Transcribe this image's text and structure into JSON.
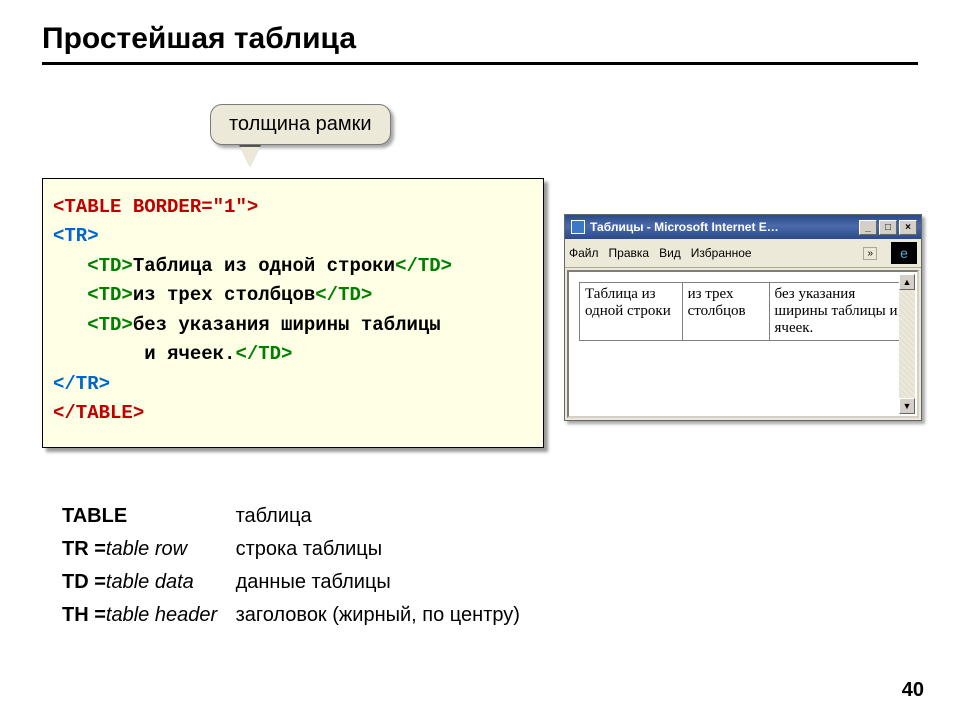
{
  "title": "Простейшая таблица",
  "callout": "толщина рамки",
  "code": {
    "line1_open": "<TABLE",
    "line1_attr": " BORDER=\"1\"",
    "line1_close": ">",
    "line2": "<TR>",
    "line3_open": "<TD>",
    "line3_text": "Таблица из одной строки",
    "line3_close": "</TD>",
    "line4_open": "<TD>",
    "line4_text": "из трех столбцов",
    "line4_close": "</TD>",
    "line5_open": "<TD>",
    "line5_text": "без указания ширины таблицы",
    "line6_text": "и ячеек.",
    "line6_close": "</TD>",
    "line7": "</TR>",
    "line8": "</TABLE>"
  },
  "defs": {
    "r1": {
      "c1": "TABLE",
      "c2": "таблица"
    },
    "r2": {
      "tag": "TR = ",
      "eng": "table row",
      "c2": "строка таблицы"
    },
    "r3": {
      "tag": "TD = ",
      "eng": "table data",
      "c2": "данные таблицы"
    },
    "r4": {
      "tag": "TH = ",
      "eng": "table header",
      "c2": "заголовок (жирный, по центру)"
    }
  },
  "browser": {
    "title": "Таблицы - Microsoft Internet E…",
    "menu": {
      "file": "Файл",
      "edit": "Правка",
      "view": "Вид",
      "fav": "Избранное",
      "chevron": "»"
    },
    "cells": {
      "c1": "Таблица из одной строки",
      "c2": "из трех столбцов",
      "c3": "без указания ширины таблицы и ячеек."
    }
  },
  "page_number": "40"
}
